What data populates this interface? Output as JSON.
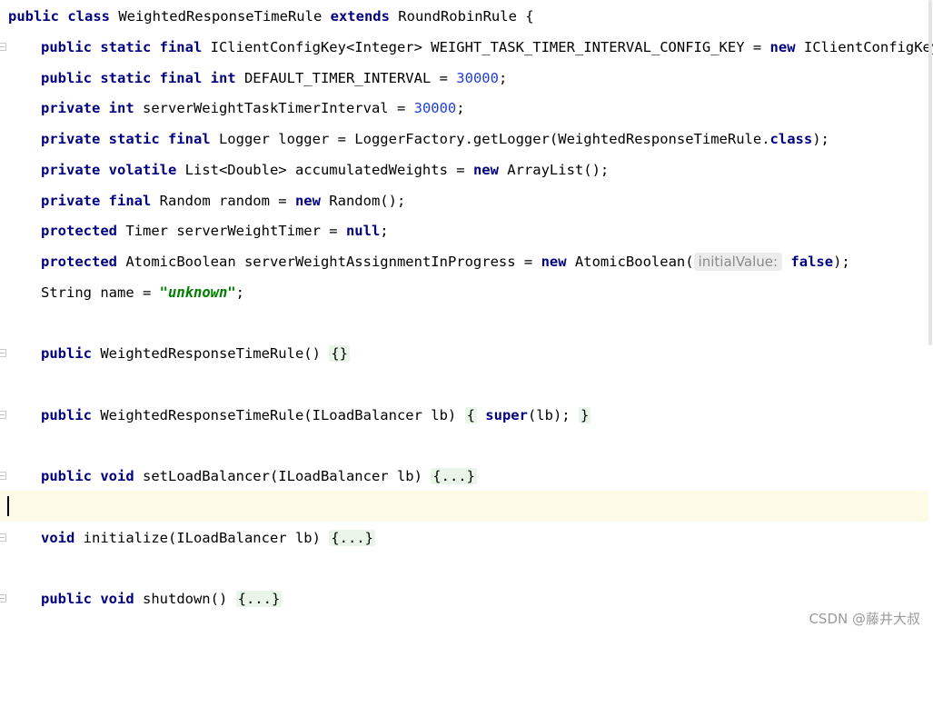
{
  "code": {
    "l1": {
      "t1": "public class",
      "t2": " WeightedResponseTimeRule ",
      "t3": "extends",
      "t4": " RoundRobinRule {"
    },
    "l2": {
      "t1": "public static final",
      "t2": " IClientConfigKey<Integer> WEIGHT_TASK_TIMER_INTERVAL_CONFIG_KEY = ",
      "t3": "new",
      "t4": " IClientConfigKey<In"
    },
    "l3": {
      "t1": "public static final int",
      "t2": " DEFAULT_TIMER_INTERVAL = ",
      "t3": "30000",
      "t4": ";"
    },
    "l4": {
      "t1": "private int",
      "t2": " serverWeightTaskTimerInterval = ",
      "t3": "30000",
      "t4": ";"
    },
    "l5": {
      "t1": "private static final",
      "t2": " Logger logger = LoggerFactory.getLogger(WeightedResponseTimeRule.",
      "t3": "class",
      "t4": ");"
    },
    "l6": {
      "t1": "private volatile",
      "t2": " List<Double> accumulatedWeights = ",
      "t3": "new",
      "t4": " ArrayList();"
    },
    "l7": {
      "t1": "private final",
      "t2": " Random random = ",
      "t3": "new",
      "t4": " Random();"
    },
    "l8": {
      "t1": "protected",
      "t2": " Timer serverWeightTimer = ",
      "t3": "null",
      "t4": ";"
    },
    "l9": {
      "t1": "protected",
      "t2": " AtomicBoolean serverWeightAssignmentInProgress = ",
      "t3": "new",
      "t4": " AtomicBoolean(",
      "hint": "initialValue:",
      "t5": "false",
      "t6": ");"
    },
    "l10": {
      "t1": "String name = ",
      "t2": "\"unknown\"",
      "t3": ";"
    },
    "l12": {
      "t1": "public",
      "t2": " WeightedResponseTimeRule() ",
      "fold": "{}"
    },
    "l14": {
      "t1": "public",
      "t2": " WeightedResponseTimeRule(ILoadBalancer lb) ",
      "f1": "{",
      "t3": " ",
      "t4": "super",
      "t5": "(lb); ",
      "f2": "}"
    },
    "l16": {
      "t1": "public void",
      "t2": " setLoadBalancer(ILoadBalancer lb) ",
      "fold": "{...}"
    },
    "l18": {
      "t1": "void",
      "t2": " initialize(ILoadBalancer lb) ",
      "fold": "{...}"
    },
    "l20": {
      "t1": "public void",
      "t2": " shutdown() ",
      "fold": "{...}"
    }
  },
  "watermark": "CSDN @藤井大叔"
}
